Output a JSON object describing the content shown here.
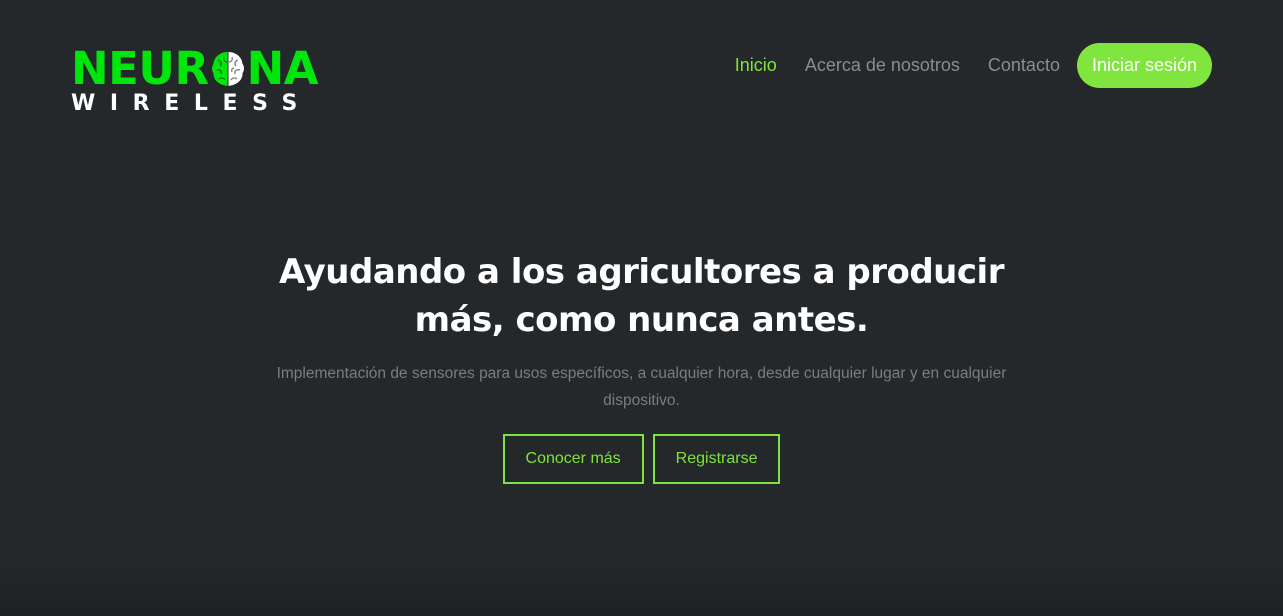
{
  "brand": {
    "logo_top_left": "NEUR",
    "logo_top_right": "NA",
    "logo_bottom": "WIRELESS",
    "colors": {
      "logo_green": "#00e60c",
      "accent": "#80e63f",
      "background": "#25282a"
    },
    "icon": "brain-icon"
  },
  "nav": {
    "items": [
      {
        "label": "Inicio",
        "active": true
      },
      {
        "label": "Acerca de nosotros",
        "active": false
      },
      {
        "label": "Contacto",
        "active": false
      }
    ],
    "login_label": "Iniciar sesión"
  },
  "hero": {
    "title_line1": "Ayudando a los agricultores a producir",
    "title_line2": "más, como nunca antes.",
    "subtitle": "Implementación de sensores para usos específicos, a cualquier hora, desde cualquier lugar y en cualquier dispositivo.",
    "primary_button": "Conocer más",
    "secondary_button": "Registrarse"
  }
}
